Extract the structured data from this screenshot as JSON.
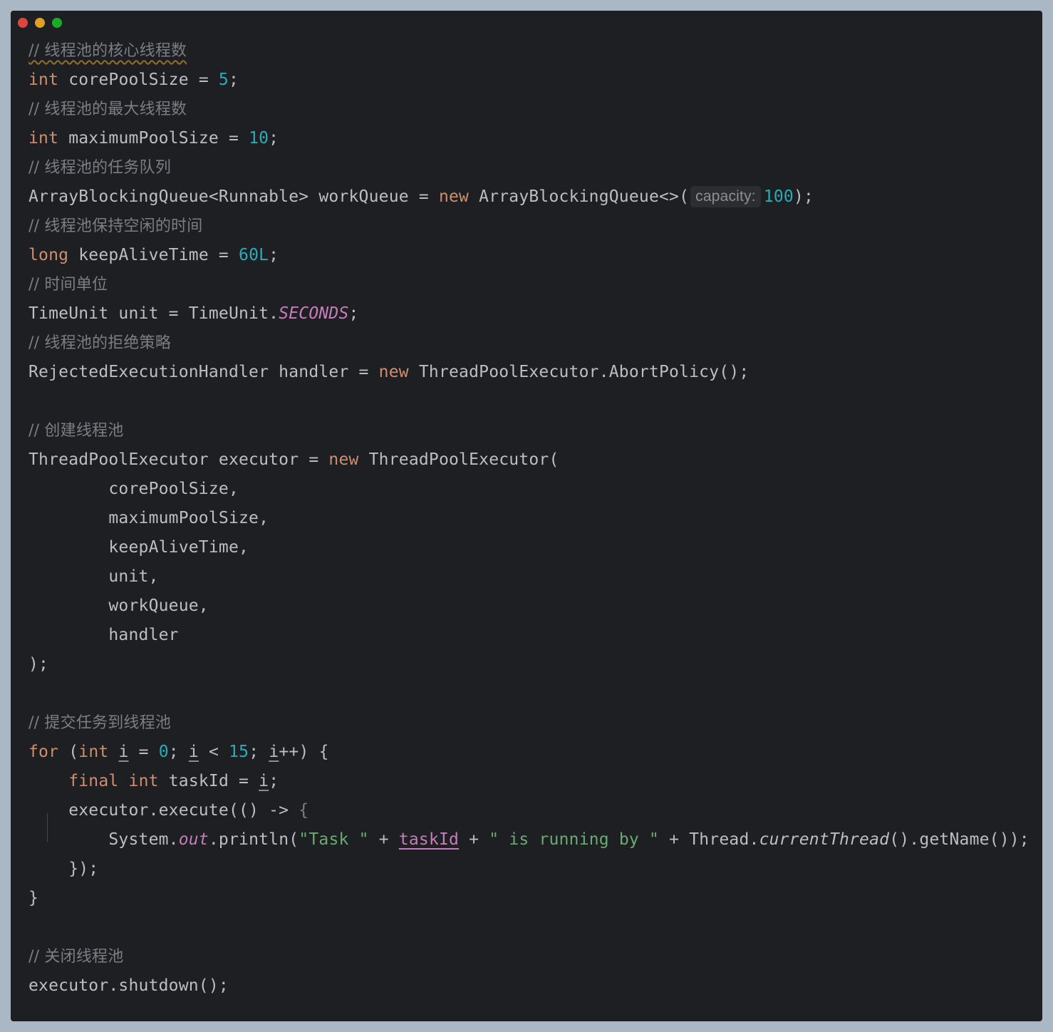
{
  "window": {
    "controls": [
      "close",
      "minimize",
      "zoom"
    ]
  },
  "code": {
    "c1": "// 线程池的核心线程数",
    "l2_kw": "int",
    "l2_mid": " corePoolSize = ",
    "l2_num": "5",
    "l2_end": ";",
    "c3": "// 线程池的最大线程数",
    "l4_kw": "int",
    "l4_mid": " maximumPoolSize = ",
    "l4_num": "10",
    "l4_end": ";",
    "c5": "// 线程池的任务队列",
    "l6_a": "ArrayBlockingQueue<Runnable> workQueue = ",
    "l6_kw": "new",
    "l6_b": " ArrayBlockingQueue<>(",
    "l6_hint": "capacity:",
    "l6_num": "100",
    "l6_end": ");",
    "c7": "// 线程池保持空闲的时间",
    "l8_kw": "long",
    "l8_mid": " keepAliveTime = ",
    "l8_num": "60L",
    "l8_end": ";",
    "c9": "// 时间单位",
    "l10_a": "TimeUnit unit = TimeUnit.",
    "l10_static": "SECONDS",
    "l10_end": ";",
    "c11": "// 线程池的拒绝策略",
    "l12_a": "RejectedExecutionHandler handler = ",
    "l12_kw": "new",
    "l12_b": " ThreadPoolExecutor.AbortPolicy();",
    "c14": "// 创建线程池",
    "l15_a": "ThreadPoolExecutor executor = ",
    "l15_kw": "new",
    "l15_b": " ThreadPoolExecutor(",
    "l16": "        corePoolSize,",
    "l17": "        maximumPoolSize,",
    "l18": "        keepAliveTime,",
    "l19": "        unit,",
    "l20": "        workQueue,",
    "l21": "        handler",
    "l22": ");",
    "c24": "// 提交任务到线程池",
    "l25_for": "for",
    "l25_a": " (",
    "l25_int": "int",
    "l25_sp": " ",
    "l25_i1": "i",
    "l25_b": " = ",
    "l25_n0": "0",
    "l25_c": "; ",
    "l25_i2": "i",
    "l25_d": " < ",
    "l25_n15": "15",
    "l25_e": "; ",
    "l25_i3": "i",
    "l25_f": "++) {",
    "l26_ind": "    ",
    "l26_final": "final",
    "l26_sp": " ",
    "l26_int": "int",
    "l26_a": " taskId = ",
    "l26_i": "i",
    "l26_end": ";",
    "l27_a": "    executor.execute(() -> ",
    "l27_brace": "{",
    "l28_a": "        System.",
    "l28_out": "out",
    "l28_b": ".println(",
    "l28_s1": "\"Task \"",
    "l28_c": " + ",
    "l28_task": "taskId",
    "l28_d": " + ",
    "l28_s2": "\" is running by \"",
    "l28_e": " + Thread.",
    "l28_ct": "currentThread",
    "l28_f": "().getName());",
    "l29": "    });",
    "l30": "}",
    "c32": "// 关闭线程池",
    "l33": "executor.shutdown();"
  }
}
